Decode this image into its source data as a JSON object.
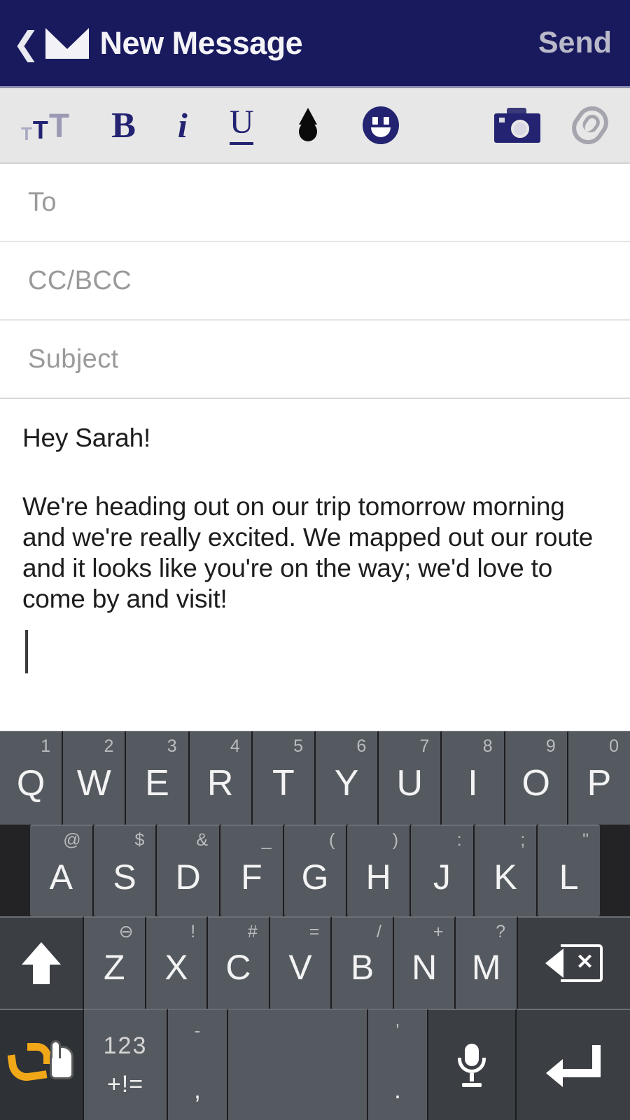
{
  "header": {
    "back_icon": "back-chevron-icon",
    "mail_icon": "envelope-icon",
    "title": "New Message",
    "send_label": "Send",
    "bg_color": "#191a5e",
    "title_color": "#f4f4f8",
    "send_color": "#b9b9c9"
  },
  "toolbar": {
    "bg_color": "#e7e7e7",
    "accent_color": "#232372",
    "items": [
      {
        "name": "text-size-icon",
        "label": "TT"
      },
      {
        "name": "bold-icon",
        "label": "B"
      },
      {
        "name": "italic-icon",
        "label": "i"
      },
      {
        "name": "underline-icon",
        "label": "U"
      },
      {
        "name": "text-color-droplet-icon",
        "label": ""
      },
      {
        "name": "emoji-icon",
        "label": ""
      },
      {
        "name": "camera-icon",
        "label": ""
      },
      {
        "name": "attachment-paperclip-icon",
        "label": ""
      }
    ]
  },
  "fields": {
    "to": {
      "placeholder": "To",
      "value": ""
    },
    "ccbcc": {
      "placeholder": "CC/BCC",
      "value": ""
    },
    "subject": {
      "placeholder": "Subject",
      "value": ""
    }
  },
  "body": {
    "greeting": "Hey Sarah!",
    "paragraph": "We're heading out on our trip tomorrow morning and we're really excited. We mapped out our route and it looks like you're on the way; we'd love to come by and visit!",
    "caret_visible": true
  },
  "keyboard": {
    "bg_color": "#232326",
    "key_color": "#555a60",
    "special_key_color": "#3b3f44",
    "row1": [
      {
        "main": "Q",
        "hint": "1"
      },
      {
        "main": "W",
        "hint": "2"
      },
      {
        "main": "E",
        "hint": "3"
      },
      {
        "main": "R",
        "hint": "4"
      },
      {
        "main": "T",
        "hint": "5"
      },
      {
        "main": "Y",
        "hint": "6"
      },
      {
        "main": "U",
        "hint": "7"
      },
      {
        "main": "I",
        "hint": "8"
      },
      {
        "main": "O",
        "hint": "9"
      },
      {
        "main": "P",
        "hint": "0"
      }
    ],
    "row2": [
      {
        "main": "A",
        "hint": "@"
      },
      {
        "main": "S",
        "hint": "$"
      },
      {
        "main": "D",
        "hint": "&"
      },
      {
        "main": "F",
        "hint": "_"
      },
      {
        "main": "G",
        "hint": "("
      },
      {
        "main": "H",
        "hint": ")"
      },
      {
        "main": "J",
        "hint": ":"
      },
      {
        "main": "K",
        "hint": ";"
      },
      {
        "main": "L",
        "hint": "\""
      }
    ],
    "row3": [
      {
        "main": "Z",
        "hint": "⊖"
      },
      {
        "main": "X",
        "hint": "!"
      },
      {
        "main": "C",
        "hint": "#"
      },
      {
        "main": "V",
        "hint": "="
      },
      {
        "main": "B",
        "hint": "/"
      },
      {
        "main": "N",
        "hint": "+"
      },
      {
        "main": "M",
        "hint": "?"
      }
    ],
    "shift_key": "shift-icon",
    "backspace_key": "backspace-icon",
    "swipe_key": "swipe-gesture-icon",
    "symbols_key": {
      "num": "123",
      "sym": "+!="
    },
    "comma_key": {
      "main": ",",
      "hint": "-"
    },
    "space_key": {
      "main": "",
      "hint": ""
    },
    "period_key": {
      "main": ".",
      "hint": "'"
    },
    "mic_key": "microphone-icon",
    "enter_key": "enter-return-icon"
  }
}
